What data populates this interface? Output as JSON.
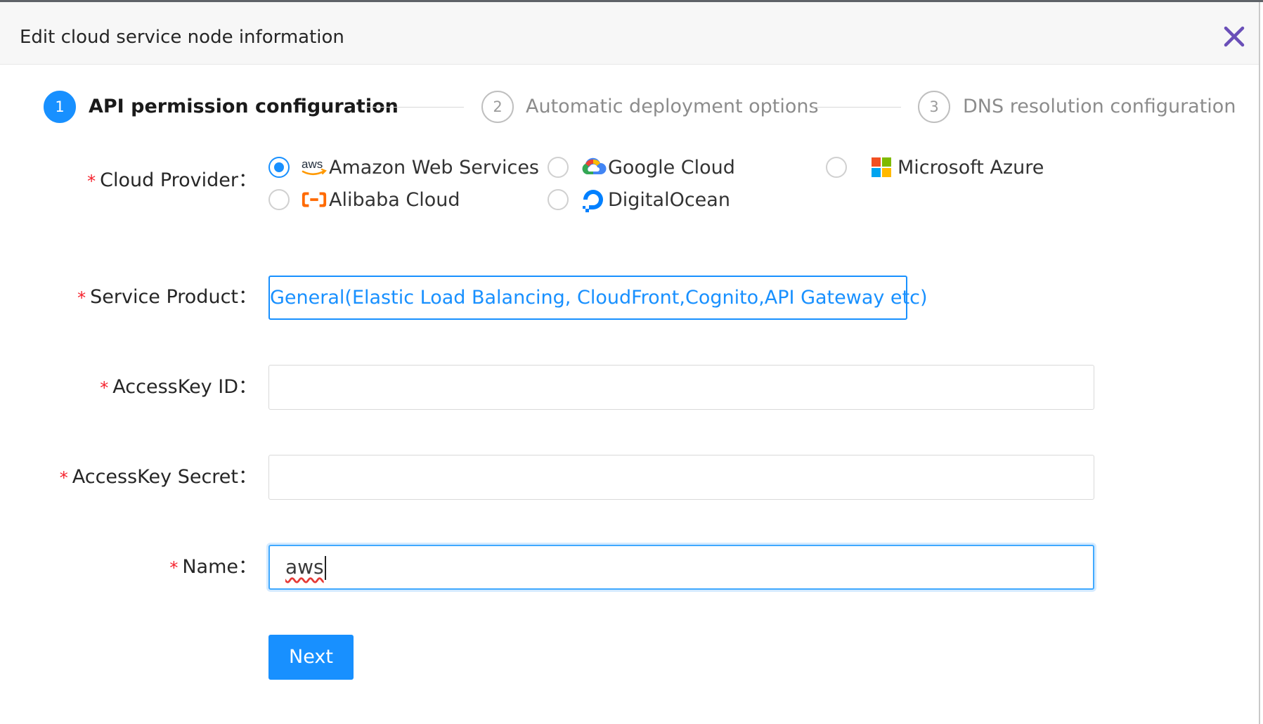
{
  "dialog": {
    "title": "Edit cloud service node information",
    "close_icon": "close-x-icon",
    "accent_color": "#1890ff",
    "close_color": "#6a4fb8"
  },
  "steps": [
    {
      "number": "1",
      "title": "API permission configuration",
      "status": "active"
    },
    {
      "number": "2",
      "title": "Automatic deployment options",
      "status": "wait"
    },
    {
      "number": "3",
      "title": "DNS resolution configuration",
      "status": "wait"
    }
  ],
  "form": {
    "required_mark": "*",
    "separator": "：",
    "cloud_provider": {
      "label": "Cloud Provider",
      "selected": "Amazon Web Services",
      "options": [
        {
          "label": "Amazon Web Services",
          "icon": "aws-icon",
          "icon_text": "aws"
        },
        {
          "label": "Google Cloud",
          "icon": "google-cloud-icon"
        },
        {
          "label": "Microsoft Azure",
          "icon": "microsoft-icon"
        },
        {
          "label": "Alibaba Cloud",
          "icon": "alibaba-cloud-icon"
        },
        {
          "label": "DigitalOcean",
          "icon": "digitalocean-icon"
        }
      ]
    },
    "service_product": {
      "label": "Service Product",
      "value": "General(Elastic Load Balancing, CloudFront,Cognito,API Gateway etc)"
    },
    "access_key_id": {
      "label": "AccessKey ID",
      "value": ""
    },
    "access_key_secret": {
      "label": "AccessKey Secret",
      "value": ""
    },
    "name": {
      "label": "Name",
      "value": "aws"
    },
    "next_label": "Next"
  }
}
